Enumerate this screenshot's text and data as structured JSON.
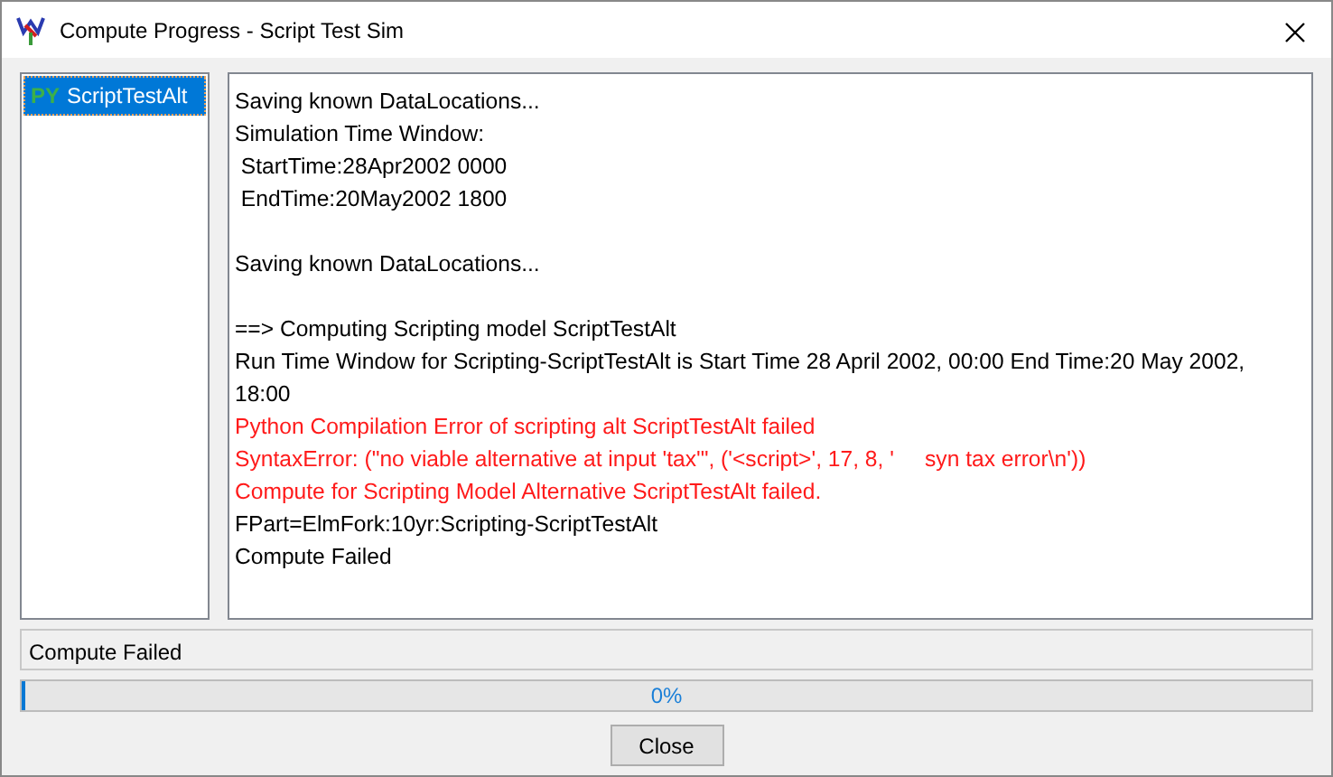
{
  "window": {
    "title": "Compute Progress - Script Test Sim"
  },
  "alternatives": [
    {
      "badge": "PY",
      "label": "ScriptTestAlt",
      "selected": true
    }
  ],
  "log": [
    {
      "kind": "normal",
      "text": "Saving known DataLocations..."
    },
    {
      "kind": "normal",
      "text": "Simulation Time Window:"
    },
    {
      "kind": "normal",
      "text": " StartTime:28Apr2002 0000"
    },
    {
      "kind": "normal",
      "text": " EndTime:20May2002 1800"
    },
    {
      "kind": "blank"
    },
    {
      "kind": "normal",
      "text": "Saving known DataLocations..."
    },
    {
      "kind": "blank"
    },
    {
      "kind": "normal",
      "text": "==> Computing Scripting model ScriptTestAlt"
    },
    {
      "kind": "normal",
      "text": "Run Time Window for Scripting-ScriptTestAlt is Start Time 28 April 2002, 00:00 End Time:20 May 2002, 18:00"
    },
    {
      "kind": "error",
      "text": "Python Compilation Error of scripting alt ScriptTestAlt failed"
    },
    {
      "kind": "error",
      "text": "SyntaxError: (\"no viable alternative at input 'tax'\", ('<script>', 17, 8, '     syn tax error\\n'))"
    },
    {
      "kind": "error",
      "text": "Compute for Scripting Model Alternative ScriptTestAlt failed."
    },
    {
      "kind": "normal",
      "text": "FPart=ElmFork:10yr:Scripting-ScriptTestAlt"
    },
    {
      "kind": "normal",
      "text": "Compute Failed"
    }
  ],
  "status": "Compute Failed",
  "progress": {
    "level": 0,
    "reading": "0%"
  },
  "buttons": [
    "Close"
  ]
}
